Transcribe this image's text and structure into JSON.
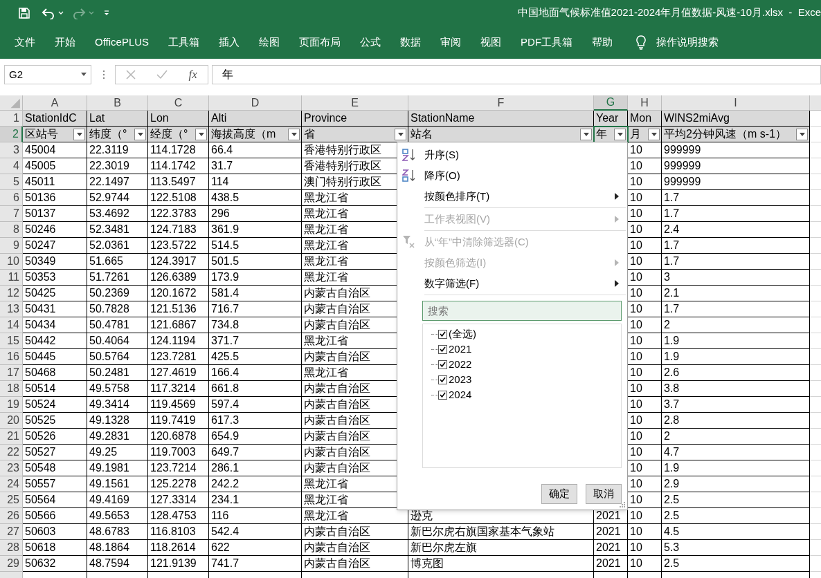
{
  "title_bar": {
    "title": "中国地面气候标准值2021-2024年月值数据-风速-10月.xlsx  -  Exce"
  },
  "ribbon_tabs": [
    "文件",
    "开始",
    "OfficePLUS",
    "工具箱",
    "插入",
    "绘图",
    "页面布局",
    "公式",
    "数据",
    "审阅",
    "视图",
    "PDF工具箱",
    "帮助"
  ],
  "tell_me": "操作说明搜索",
  "formula_bar": {
    "name_box": "G2",
    "function_label": "fx",
    "value": "年"
  },
  "sheet": {
    "columns": [
      {
        "letter": "A",
        "selected": false
      },
      {
        "letter": "B",
        "selected": false
      },
      {
        "letter": "C",
        "selected": false
      },
      {
        "letter": "D",
        "selected": false
      },
      {
        "letter": "E",
        "selected": false
      },
      {
        "letter": "F",
        "selected": false
      },
      {
        "letter": "G",
        "selected": true
      },
      {
        "letter": "H",
        "selected": false
      },
      {
        "letter": "I",
        "selected": false
      }
    ],
    "rows": [
      {
        "number": "1",
        "selected": false,
        "kind": "field",
        "cells": {
          "A": "StationIdC",
          "B": "Lat",
          "C": "Lon",
          "D": "Alti",
          "E": "Province",
          "F": "StationName",
          "G": "Year",
          "H": "Mon",
          "I": "WINS2miAvg"
        }
      },
      {
        "number": "2",
        "selected": true,
        "kind": "filter",
        "cells": {
          "A": "区站号",
          "B": "纬度（°",
          "C": "经度（°",
          "D": "海拔高度（m",
          "E": "省",
          "F": "站名",
          "G": "年",
          "H": "月",
          "I": "平均2分钟风速（m s-1）"
        }
      },
      {
        "number": "3",
        "selected": false,
        "kind": "data",
        "cells": {
          "A": "45004",
          "B": "22.3119",
          "C": "114.1728",
          "D": "66.4",
          "E": "香港特别行政区",
          "H": "10",
          "I": "999999"
        }
      },
      {
        "number": "4",
        "selected": false,
        "kind": "data",
        "cells": {
          "A": "45005",
          "B": "22.3019",
          "C": "114.1742",
          "D": "31.7",
          "E": "香港特别行政区",
          "H": "10",
          "I": "999999"
        }
      },
      {
        "number": "5",
        "selected": false,
        "kind": "data",
        "cells": {
          "A": "45011",
          "B": "22.1497",
          "C": "113.5497",
          "D": "114",
          "E": "澳门特别行政区",
          "H": "10",
          "I": "999999"
        }
      },
      {
        "number": "6",
        "selected": false,
        "kind": "data",
        "cells": {
          "A": "50136",
          "B": "52.9744",
          "C": "122.5108",
          "D": "438.5",
          "E": "黑龙江省",
          "H": "10",
          "I": "1.7"
        }
      },
      {
        "number": "7",
        "selected": false,
        "kind": "data",
        "cells": {
          "A": "50137",
          "B": "53.4692",
          "C": "122.3783",
          "D": "296",
          "E": "黑龙江省",
          "H": "10",
          "I": "1.7"
        }
      },
      {
        "number": "8",
        "selected": false,
        "kind": "data",
        "cells": {
          "A": "50246",
          "B": "52.3481",
          "C": "124.7183",
          "D": "361.9",
          "E": "黑龙江省",
          "H": "10",
          "I": "2.4"
        }
      },
      {
        "number": "9",
        "selected": false,
        "kind": "data",
        "cells": {
          "A": "50247",
          "B": "52.0361",
          "C": "123.5722",
          "D": "514.5",
          "E": "黑龙江省",
          "H": "10",
          "I": "1.7"
        }
      },
      {
        "number": "10",
        "selected": false,
        "kind": "data",
        "cells": {
          "A": "50349",
          "B": "51.665",
          "C": "124.3917",
          "D": "501.5",
          "E": "黑龙江省",
          "H": "10",
          "I": "1.7"
        }
      },
      {
        "number": "11",
        "selected": false,
        "kind": "data",
        "cells": {
          "A": "50353",
          "B": "51.7261",
          "C": "126.6389",
          "D": "173.9",
          "E": "黑龙江省",
          "H": "10",
          "I": "3"
        }
      },
      {
        "number": "12",
        "selected": false,
        "kind": "data",
        "cells": {
          "A": "50425",
          "B": "50.2369",
          "C": "120.1672",
          "D": "581.4",
          "E": "内蒙古自治区",
          "H": "10",
          "I": "2.1"
        }
      },
      {
        "number": "13",
        "selected": false,
        "kind": "data",
        "cells": {
          "A": "50431",
          "B": "50.7828",
          "C": "121.5136",
          "D": "716.7",
          "E": "内蒙古自治区",
          "H": "10",
          "I": "1.7"
        }
      },
      {
        "number": "14",
        "selected": false,
        "kind": "data",
        "cells": {
          "A": "50434",
          "B": "50.4781",
          "C": "121.6867",
          "D": "734.8",
          "E": "内蒙古自治区",
          "H": "10",
          "I": "2"
        }
      },
      {
        "number": "15",
        "selected": false,
        "kind": "data",
        "cells": {
          "A": "50442",
          "B": "50.4064",
          "C": "124.1194",
          "D": "371.7",
          "E": "黑龙江省",
          "H": "10",
          "I": "1.9"
        }
      },
      {
        "number": "16",
        "selected": false,
        "kind": "data",
        "cells": {
          "A": "50445",
          "B": "50.5764",
          "C": "123.7281",
          "D": "425.5",
          "E": "内蒙古自治区",
          "H": "10",
          "I": "1.9"
        }
      },
      {
        "number": "17",
        "selected": false,
        "kind": "data",
        "cells": {
          "A": "50468",
          "B": "50.2481",
          "C": "127.4619",
          "D": "166.4",
          "E": "黑龙江省",
          "H": "10",
          "I": "2.6"
        }
      },
      {
        "number": "18",
        "selected": false,
        "kind": "data",
        "cells": {
          "A": "50514",
          "B": "49.5758",
          "C": "117.3214",
          "D": "661.8",
          "E": "内蒙古自治区",
          "H": "10",
          "I": "3.8"
        }
      },
      {
        "number": "19",
        "selected": false,
        "kind": "data",
        "cells": {
          "A": "50524",
          "B": "49.3414",
          "C": "119.4569",
          "D": "597.4",
          "E": "内蒙古自治区",
          "H": "10",
          "I": "3.7"
        }
      },
      {
        "number": "20",
        "selected": false,
        "kind": "data",
        "cells": {
          "A": "50525",
          "B": "49.1328",
          "C": "119.7419",
          "D": "617.3",
          "E": "内蒙古自治区",
          "H": "10",
          "I": "2.8"
        }
      },
      {
        "number": "21",
        "selected": false,
        "kind": "data",
        "cells": {
          "A": "50526",
          "B": "49.2831",
          "C": "120.6878",
          "D": "654.9",
          "E": "内蒙古自治区",
          "H": "10",
          "I": "2"
        }
      },
      {
        "number": "22",
        "selected": false,
        "kind": "data",
        "cells": {
          "A": "50527",
          "B": "49.25",
          "C": "119.7003",
          "D": "649.7",
          "E": "内蒙古自治区",
          "H": "10",
          "I": "4.7"
        }
      },
      {
        "number": "23",
        "selected": false,
        "kind": "data",
        "cells": {
          "A": "50548",
          "B": "49.1981",
          "C": "123.7214",
          "D": "286.1",
          "E": "内蒙古自治区",
          "H": "10",
          "I": "1.9"
        }
      },
      {
        "number": "24",
        "selected": false,
        "kind": "data",
        "cells": {
          "A": "50557",
          "B": "49.1561",
          "C": "125.2278",
          "D": "242.2",
          "E": "黑龙江省",
          "H": "10",
          "I": "2.9"
        }
      },
      {
        "number": "25",
        "selected": false,
        "kind": "data",
        "cells": {
          "A": "50564",
          "B": "49.4169",
          "C": "127.3314",
          "D": "234.1",
          "E": "黑龙江省",
          "H": "10",
          "I": "2.5"
        }
      },
      {
        "number": "26",
        "selected": false,
        "kind": "data",
        "cells": {
          "A": "50566",
          "B": "49.5653",
          "C": "128.4753",
          "D": "116",
          "E": "黑龙江省",
          "F": "逊克",
          "G": "2021",
          "H": "10",
          "I": "2.5"
        }
      },
      {
        "number": "27",
        "selected": false,
        "kind": "data",
        "cells": {
          "A": "50603",
          "B": "48.6783",
          "C": "116.8103",
          "D": "542.4",
          "E": "内蒙古自治区",
          "F": "新巴尔虎右旗国家基本气象站",
          "G": "2021",
          "H": "10",
          "I": "4.5"
        }
      },
      {
        "number": "28",
        "selected": false,
        "kind": "data",
        "cells": {
          "A": "50618",
          "B": "48.1864",
          "C": "118.2614",
          "D": "622",
          "E": "内蒙古自治区",
          "F": "新巴尔虎左旗",
          "G": "2021",
          "H": "10",
          "I": "5.3"
        }
      },
      {
        "number": "29",
        "selected": false,
        "kind": "data",
        "cells": {
          "A": "50632",
          "B": "48.7594",
          "C": "121.9139",
          "D": "741.7",
          "E": "内蒙古自治区",
          "F": "博克图",
          "G": "2021",
          "H": "10",
          "I": "2.5"
        }
      }
    ]
  },
  "filter_menu": {
    "items": [
      {
        "kind": "sort_asc",
        "label": "升序(S)",
        "disabled": false
      },
      {
        "kind": "sort_desc",
        "label": "降序(O)",
        "disabled": false
      },
      {
        "kind": "submenu",
        "label": "按颜色排序(T)",
        "disabled": false
      },
      {
        "kind": "separator"
      },
      {
        "kind": "submenu",
        "label": "工作表视图(V)",
        "disabled": true
      },
      {
        "kind": "separator"
      },
      {
        "kind": "clear",
        "label": "从“年”中清除筛选器(C)",
        "disabled": true
      },
      {
        "kind": "submenu",
        "label": "按颜色筛选(I)",
        "disabled": true
      },
      {
        "kind": "submenu",
        "label": "数字筛选(F)",
        "disabled": false
      },
      {
        "kind": "separator"
      }
    ],
    "search_placeholder": "搜索",
    "values": [
      {
        "label": "(全选)",
        "checked": true
      },
      {
        "label": "2021",
        "checked": true
      },
      {
        "label": "2022",
        "checked": true
      },
      {
        "label": "2023",
        "checked": true
      },
      {
        "label": "2024",
        "checked": true
      }
    ],
    "buttons": [
      "确定",
      "取消"
    ]
  }
}
